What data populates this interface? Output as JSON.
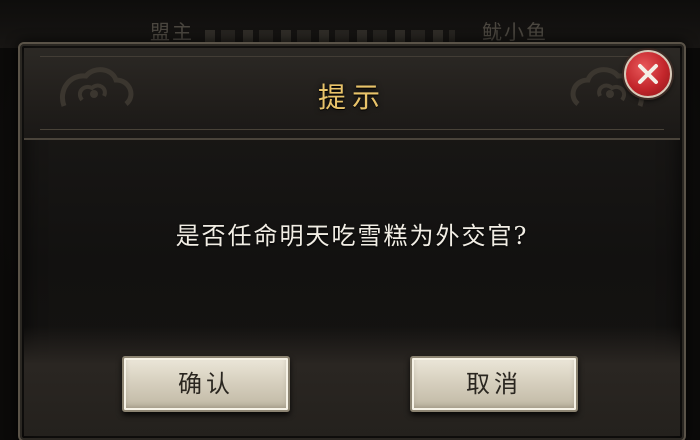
{
  "background": {
    "left_text": "盟主",
    "right_text": "鱿小鱼"
  },
  "dialog": {
    "title": "提示",
    "message": "是否任命明天吃雪糕为外交官?",
    "confirm_label": "确认",
    "cancel_label": "取消",
    "close_icon": "close-icon"
  },
  "colors": {
    "title": "#e8c36a",
    "message": "#f1ede4",
    "close_button": "#c3262b"
  }
}
